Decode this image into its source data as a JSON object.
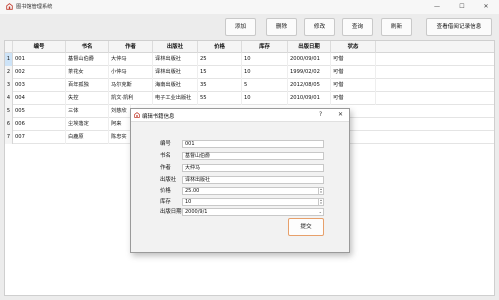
{
  "window": {
    "title": "图书馆管理系统",
    "minimize": "—",
    "maximize": "☐",
    "close": "✕"
  },
  "toolbar": {
    "add": "添加",
    "delete": "删除",
    "edit": "修改",
    "query": "查询",
    "refresh": "刷新",
    "borrow_info": "查看借阅记录信息"
  },
  "table": {
    "columns": [
      "编号",
      "书名",
      "作者",
      "出版社",
      "价格",
      "库存",
      "出版日期",
      "状态"
    ],
    "rows": [
      {
        "num": "1",
        "cells": [
          "001",
          "基督山伯爵",
          "大仲马",
          "译林出版社",
          "25",
          "10",
          "2000/09/01",
          "可借"
        ]
      },
      {
        "num": "2",
        "cells": [
          "002",
          "茶花女",
          "小仲马",
          "译林出版社",
          "15",
          "10",
          "1999/02/02",
          "可借"
        ]
      },
      {
        "num": "3",
        "cells": [
          "003",
          "百年孤独",
          "马尔克斯",
          "海南出版社",
          "35",
          "5",
          "2012/08/05",
          "可借"
        ]
      },
      {
        "num": "4",
        "cells": [
          "004",
          "失控",
          "凯文·凯利",
          "电子工业出版社",
          "55",
          "10",
          "2010/09/01",
          "可借"
        ]
      },
      {
        "num": "5",
        "cells": [
          "005",
          "三体",
          "刘慈欣",
          "",
          "",
          "",
          "",
          ""
        ]
      },
      {
        "num": "6",
        "cells": [
          "006",
          "尘埃落定",
          "阿来",
          "",
          "",
          "",
          "",
          ""
        ]
      },
      {
        "num": "7",
        "cells": [
          "007",
          "白鹿原",
          "陈忠实",
          "",
          "",
          "",
          "",
          ""
        ]
      }
    ]
  },
  "dialog": {
    "title": "编辑书籍信息",
    "help": "?",
    "close": "✕",
    "fields": [
      {
        "label": "编号",
        "value": "001"
      },
      {
        "label": "书名",
        "value": "基督山伯爵"
      },
      {
        "label": "作者",
        "value": "大仲马"
      },
      {
        "label": "出版社",
        "value": "译林出版社"
      },
      {
        "label": "价格",
        "value": "25.00"
      },
      {
        "label": "库存",
        "value": "10"
      },
      {
        "label": "出版日期",
        "value": "2000/9/1"
      }
    ],
    "submit": "提交"
  },
  "colors": {
    "accent_border": "#e7a06b",
    "selection": "#cde3f7",
    "icon": "#c0392b"
  }
}
